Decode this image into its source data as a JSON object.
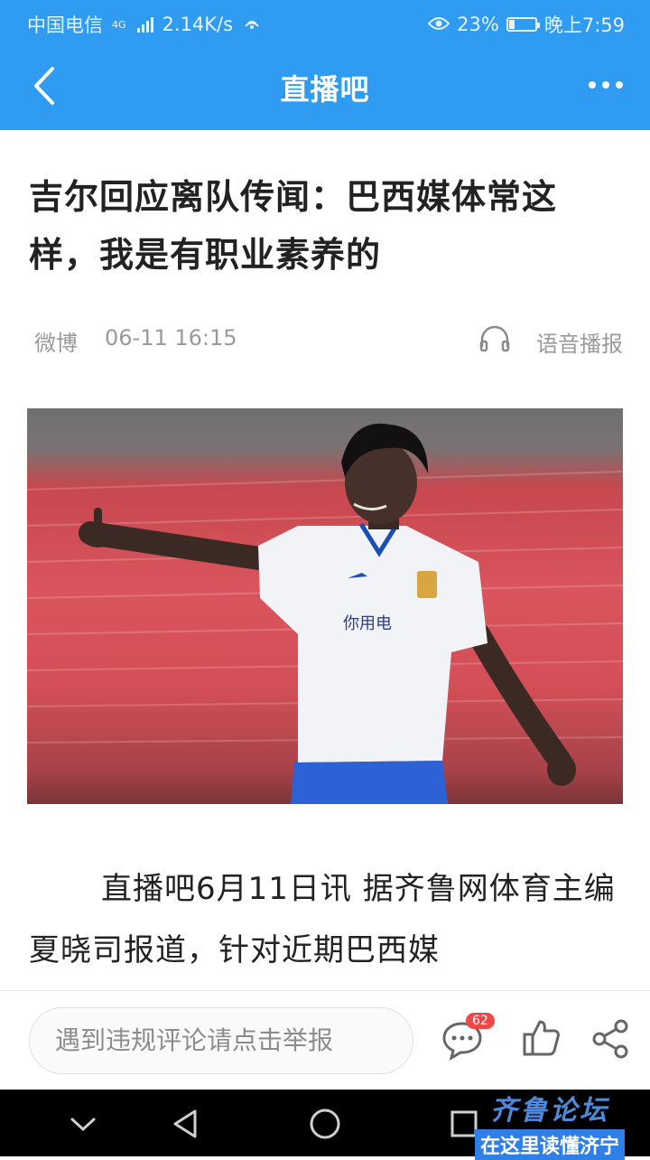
{
  "status_bar": {
    "carrier": "中国电信",
    "network": "4G",
    "speed": "2.14K/s",
    "battery": "23%",
    "battery_level": 0.23,
    "time": "晚上7:59"
  },
  "app_bar": {
    "title": "直播吧",
    "back_icon": "chevron-left-icon",
    "more_icon": "more-dots-icon"
  },
  "article": {
    "headline": "吉尔回应离队传闻：巴西媒体常这样，我是有职业素养的",
    "source": "微博",
    "datetime": "06-11 16:15",
    "audio_label": "语音播报",
    "body": "直播吧6月11日讯 据齐鲁网体育主编夏晓司报道，针对近期巴西媒"
  },
  "bottom_bar": {
    "report_placeholder": "遇到违规评论请点击举报",
    "comment_count": "62"
  },
  "watermark": {
    "line1": "齐鲁论坛",
    "line2": "在这里读懂济宁"
  },
  "colors": {
    "brand": "#2f9bf1",
    "badge": "#f04747"
  }
}
